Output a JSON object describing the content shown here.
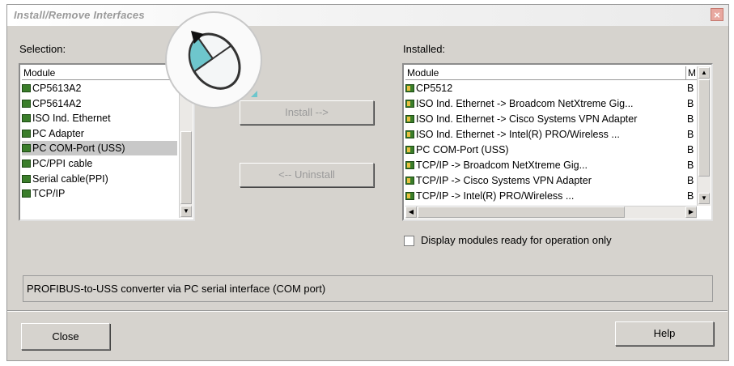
{
  "window": {
    "title": "Install/Remove Interfaces"
  },
  "selection": {
    "label": "Selection:",
    "header": "Module",
    "items": [
      {
        "text": "CP5613A2",
        "selected": false
      },
      {
        "text": "CP5614A2",
        "selected": false
      },
      {
        "text": "ISO Ind. Ethernet",
        "selected": false
      },
      {
        "text": "PC Adapter",
        "selected": false
      },
      {
        "text": "PC COM-Port (USS)",
        "selected": true
      },
      {
        "text": "PC/PPI cable",
        "selected": false
      },
      {
        "text": "Serial cable(PPI)",
        "selected": false
      },
      {
        "text": "TCP/IP",
        "selected": false
      }
    ]
  },
  "installed": {
    "label": "Installed:",
    "header_module": "Module",
    "header_col2": "M",
    "items": [
      {
        "text": "CP5512",
        "col2": "B"
      },
      {
        "text": "ISO Ind. Ethernet -> Broadcom NetXtreme Gig...",
        "col2": "B"
      },
      {
        "text": "ISO Ind. Ethernet -> Cisco Systems VPN Adapter",
        "col2": "B"
      },
      {
        "text": "ISO Ind. Ethernet -> Intel(R) PRO/Wireless ...",
        "col2": "B"
      },
      {
        "text": "PC COM-Port (USS)",
        "col2": "B"
      },
      {
        "text": "TCP/IP -> Broadcom NetXtreme Gig...",
        "col2": "B"
      },
      {
        "text": "TCP/IP -> Cisco Systems VPN Adapter",
        "col2": "B"
      },
      {
        "text": "TCP/IP -> Intel(R) PRO/Wireless ...",
        "col2": "B"
      }
    ]
  },
  "buttons": {
    "install": "Install -->",
    "uninstall": "<-- Uninstall",
    "close": "Close",
    "help": "Help"
  },
  "checkbox": {
    "label": "Display modules ready for operation only",
    "checked": false
  },
  "description": "PROFIBUS-to-USS converter via PC serial interface (COM port)",
  "colors": {
    "dialog_bg": "#d6d3ce",
    "module_icon": "#3a7d2a",
    "close_button": "#e8a8a0"
  }
}
